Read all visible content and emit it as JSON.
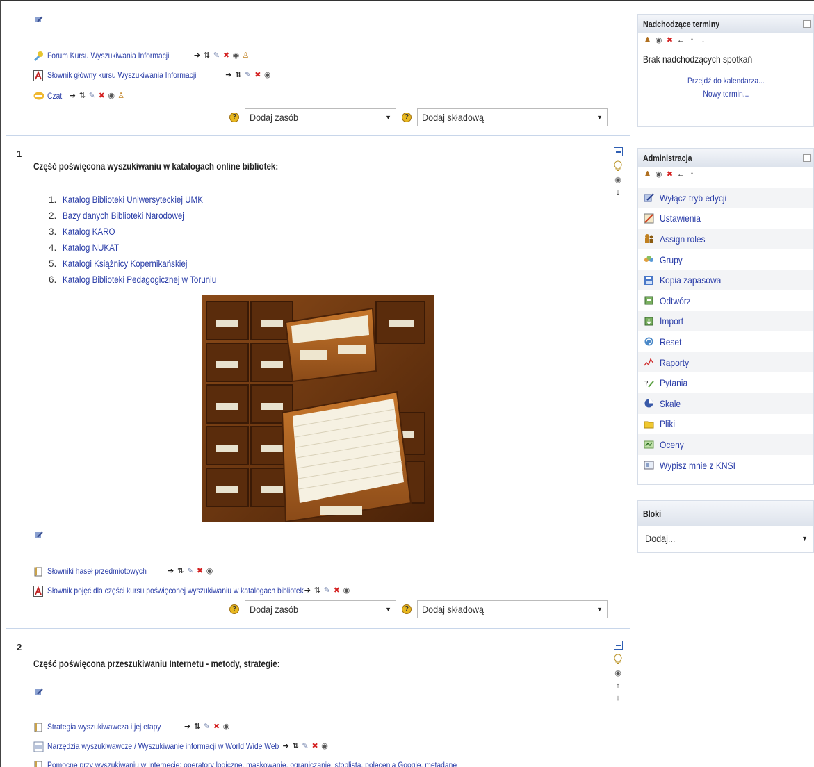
{
  "section0": {
    "activities": [
      {
        "icon": "forum-icon",
        "label": "Forum Kursu Wyszukiwania Informacji"
      },
      {
        "icon": "glossary-icon",
        "label": "Słownik główny kursu Wyszukiwania Informacji"
      },
      {
        "icon": "chat-icon",
        "label": "Czat"
      }
    ],
    "add_resource": "Dodaj zasób",
    "add_activity": "Dodaj składową"
  },
  "section1": {
    "number": "1",
    "heading": "Część poświęcona wyszukiwaniu w katalogach online bibliotek:",
    "links": [
      {
        "n": "1.",
        "label": "Katalog Biblioteki Uniwersyteckiej UMK"
      },
      {
        "n": "2.",
        "label": "Bazy danych Biblioteki Narodowej"
      },
      {
        "n": "3.",
        "label": "Katalog KARO"
      },
      {
        "n": "4.",
        "label": "Katalog NUKAT"
      },
      {
        "n": "5.",
        "label": "Katalogi Książnicy Kopernikańskiej"
      },
      {
        "n": "6.",
        "label": "Katalog Biblioteki Pedagogicznej w Toruniu"
      }
    ],
    "activities": [
      {
        "icon": "book-icon",
        "label": "Słowniki haseł przedmiotowych"
      },
      {
        "icon": "glossary-icon",
        "label": "Słownik pojęć dla części kursu poświęconej wyszukiwaniu w katalogach bibliotek"
      }
    ],
    "add_resource": "Dodaj zasób",
    "add_activity": "Dodaj składową"
  },
  "section2": {
    "number": "2",
    "heading": "Część poświęcona przeszukiwaniu Internetu - metody, strategie:",
    "activities": [
      {
        "icon": "book-icon",
        "label": "Strategia wyszukiwawcza i jej etapy"
      },
      {
        "icon": "page-icon",
        "label": "Narzędzia wyszukiwawcze / Wyszukiwanie informacji w World Wide Web"
      },
      {
        "icon": "book-icon",
        "label": "Pomocne przy wyszukiwaniu w Internecie: operatory logiczne, maskowanie, ograniczanie, stoplista, polecenia Google, metadane"
      }
    ]
  },
  "upcoming": {
    "title": "Nadchodzące terminy",
    "empty": "Brak nadchodzących spotkań",
    "calendar_link": "Przejdź do kalendarza...",
    "new_event": "Nowy termin..."
  },
  "admin": {
    "title": "Administracja",
    "items": [
      {
        "icon": "edit-icon",
        "label": "Wyłącz tryb edycji"
      },
      {
        "icon": "settings-icon",
        "label": "Ustawienia"
      },
      {
        "icon": "roles-icon",
        "label": "Assign roles"
      },
      {
        "icon": "groups-icon",
        "label": "Grupy"
      },
      {
        "icon": "backup-icon",
        "label": "Kopia zapasowa"
      },
      {
        "icon": "restore-icon",
        "label": "Odtwórz"
      },
      {
        "icon": "import-icon",
        "label": "Import"
      },
      {
        "icon": "reset-icon",
        "label": "Reset"
      },
      {
        "icon": "reports-icon",
        "label": "Raporty"
      },
      {
        "icon": "questions-icon",
        "label": "Pytania"
      },
      {
        "icon": "scales-icon",
        "label": "Skale"
      },
      {
        "icon": "files-icon",
        "label": "Pliki"
      },
      {
        "icon": "grades-icon",
        "label": "Oceny"
      },
      {
        "icon": "unenrol-icon",
        "label": "Wypisz mnie z KNSI"
      }
    ]
  },
  "blocks": {
    "title": "Bloki",
    "add_placeholder": "Dodaj..."
  }
}
